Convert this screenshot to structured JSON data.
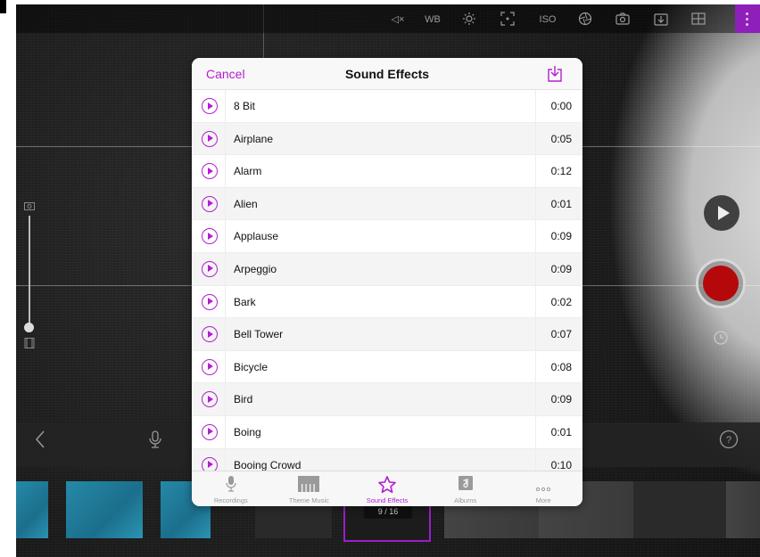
{
  "toolbar": {
    "items": [
      {
        "name": "mute-icon",
        "label": "◁×"
      },
      {
        "name": "white-balance",
        "label": "WB"
      },
      {
        "name": "exposure-icon",
        "label": ""
      },
      {
        "name": "focus-icon",
        "label": ""
      },
      {
        "name": "iso",
        "label": "ISO"
      },
      {
        "name": "aperture-icon",
        "label": ""
      },
      {
        "name": "flip-camera-icon",
        "label": ""
      },
      {
        "name": "save-icon",
        "label": ""
      },
      {
        "name": "grid-icon",
        "label": ""
      },
      {
        "name": "more-vertical-icon",
        "label": ""
      }
    ]
  },
  "modal": {
    "cancel_label": "Cancel",
    "title": "Sound Effects",
    "items": [
      {
        "name": "8 Bit",
        "duration": "0:00"
      },
      {
        "name": "Airplane",
        "duration": "0:05"
      },
      {
        "name": "Alarm",
        "duration": "0:12"
      },
      {
        "name": "Alien",
        "duration": "0:01"
      },
      {
        "name": "Applause",
        "duration": "0:09"
      },
      {
        "name": "Arpeggio",
        "duration": "0:09"
      },
      {
        "name": "Bark",
        "duration": "0:02"
      },
      {
        "name": "Bell Tower",
        "duration": "0:07"
      },
      {
        "name": "Bicycle",
        "duration": "0:08"
      },
      {
        "name": "Bird",
        "duration": "0:09"
      },
      {
        "name": "Boing",
        "duration": "0:01"
      },
      {
        "name": "Booing Crowd",
        "duration": "0:10"
      }
    ],
    "tabs": [
      {
        "label": "Recordings",
        "icon": "microphone-icon"
      },
      {
        "label": "Theme Music",
        "icon": "piano-icon"
      },
      {
        "label": "Sound Effects",
        "icon": "star-icon",
        "active": true
      },
      {
        "label": "Albums",
        "icon": "music-note-icon"
      },
      {
        "label": "More",
        "icon": "more-dots-icon"
      }
    ]
  },
  "timeline": {
    "counter": "9 / 16"
  },
  "colors": {
    "accent": "#b31fd0",
    "record": "#b5080b",
    "toolbar_active": "#8e1fb8"
  }
}
